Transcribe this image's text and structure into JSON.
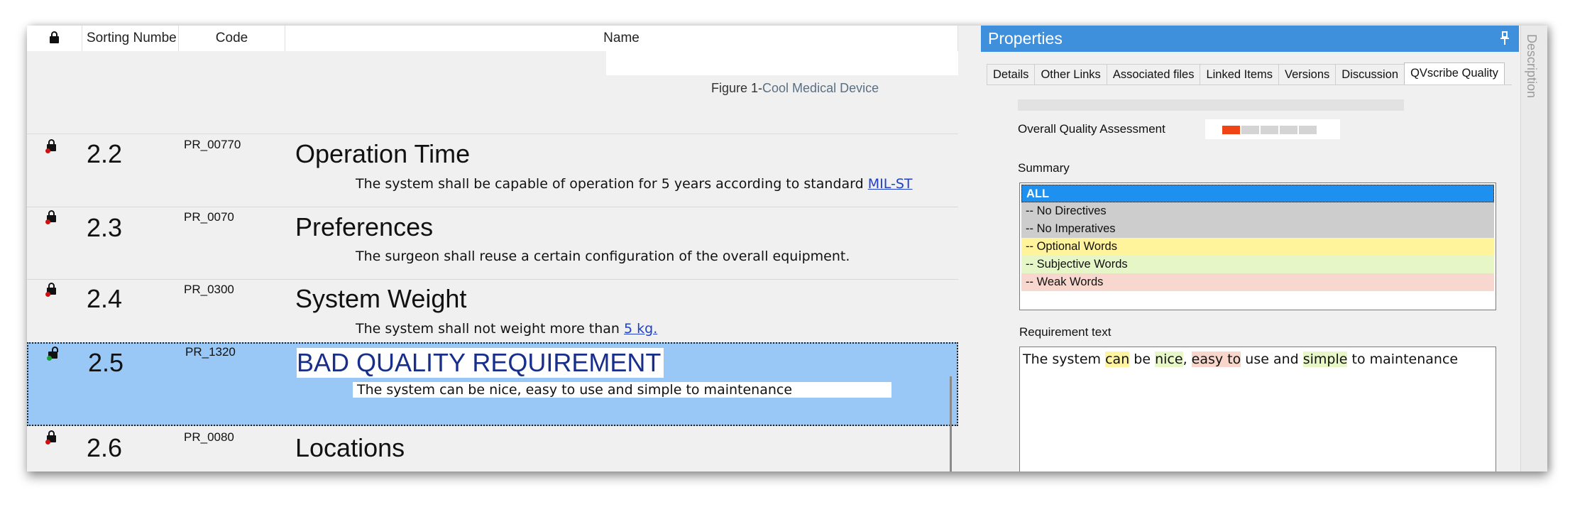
{
  "grid": {
    "headers": {
      "sorting_number": "Sorting Numbe",
      "code": "Code",
      "name": "Name"
    },
    "figure_caption": {
      "prefix": "Figure 1-",
      "text": "Cool Medical Device"
    },
    "rows": [
      {
        "number": "2.2",
        "code": "PR_00770",
        "title": "Operation Time",
        "desc_text": "The system shall be capable of operation for 5 years according to standard ",
        "desc_link": "MIL-ST"
      },
      {
        "number": "2.3",
        "code": "PR_0070",
        "title": "Preferences",
        "desc_text": "The surgeon shall  reuse a certain configuration of the overall equipment.",
        "desc_link": ""
      },
      {
        "number": "2.4",
        "code": "PR_0300",
        "title": "System Weight",
        "desc_text": "The system shall not weight more than ",
        "desc_link": "5 kg."
      },
      {
        "number": "2.5",
        "code": "PR_1320",
        "title": "BAD QUALITY REQUIREMENT",
        "desc_text": "The system can be nice, easy to use and simple to maintenance",
        "desc_link": ""
      },
      {
        "number": "2.6",
        "code": "PR_0080",
        "title": "Locations",
        "desc_text": "",
        "desc_link": ""
      }
    ]
  },
  "properties": {
    "title": "Properties",
    "tabs": [
      "Details",
      "Other Links",
      "Associated files",
      "Linked Items",
      "Versions",
      "Discussion",
      "QVscribe Quality"
    ],
    "active_tab": "QVscribe Quality",
    "overall_quality_label": "Overall Quality Assessment",
    "overall_quality_score": "1 of 5",
    "summary_label": "Summary",
    "summary_items": [
      {
        "label": "ALL",
        "color": "#1e90f0"
      },
      {
        "label": "-- No Directives",
        "color": "#cdcdcd"
      },
      {
        "label": "-- No Imperatives",
        "color": "#cdcdcd"
      },
      {
        "label": "-- Optional Words",
        "color": "#fff49c"
      },
      {
        "label": "-- Subjective Words",
        "color": "#e6f6c6"
      },
      {
        "label": "-- Weak Words",
        "color": "#f8d8ce"
      }
    ],
    "requirement_label": "Requirement text",
    "requirement_parts": [
      {
        "text": "The system ",
        "kind": "plain"
      },
      {
        "text": "can",
        "kind": "optional"
      },
      {
        "text": " be ",
        "kind": "plain"
      },
      {
        "text": "nice",
        "kind": "subjective"
      },
      {
        "text": ", ",
        "kind": "plain"
      },
      {
        "text": "easy to",
        "kind": "weak"
      },
      {
        "text": " use and ",
        "kind": "plain"
      },
      {
        "text": "simple",
        "kind": "subjective"
      },
      {
        "text": " to maintenance",
        "kind": "plain"
      }
    ],
    "side_tab": "Description"
  },
  "colors": {
    "panel_title_bg": "#3f90dc",
    "selected_row_bg": "#99c8f6",
    "quality_red": "#f04414",
    "link_blue": "#1f3fc9"
  }
}
